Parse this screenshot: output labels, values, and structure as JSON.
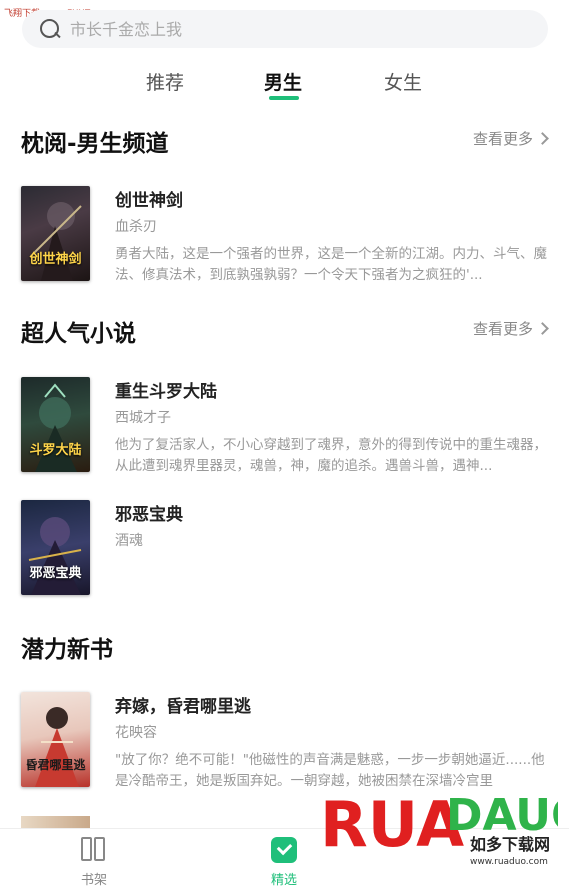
{
  "watermark": "飞翔下载 www.FXXZ.com",
  "search": {
    "placeholder": "市长千金恋上我"
  },
  "tabs": [
    {
      "label": "推荐"
    },
    {
      "label": "男生"
    },
    {
      "label": "女生"
    }
  ],
  "sections": [
    {
      "title": "枕阅-男生频道",
      "more": "查看更多",
      "books": [
        {
          "title": "创世神剑",
          "author": "血杀刃",
          "desc": "勇者大陆，这是一个强者的世界，这是一个全新的江湖。内力、斗气、魔法、修真法术，到底孰强孰弱？一个令天下强者为之疯狂的'...",
          "cover_text": "创世神剑"
        }
      ]
    },
    {
      "title": "超人气小说",
      "more": "查看更多",
      "books": [
        {
          "title": "重生斗罗大陆",
          "author": "西城才子",
          "desc": "他为了复活家人，不小心穿越到了魂界，意外的得到传说中的重生魂器，从此遭到魂界里器灵，魂兽，神，魔的追杀。遇兽斗兽，遇神...",
          "cover_text": "斗罗大陆"
        },
        {
          "title": "邪恶宝典",
          "author": "酒魂",
          "desc": "",
          "cover_text": "邪恶宝典"
        }
      ]
    },
    {
      "title": "潜力新书",
      "more": "",
      "books": [
        {
          "title": "弃嫁，昏君哪里逃",
          "author": "花映容",
          "desc": "\"放了你？绝不可能！\"他磁性的声音满是魅惑，一步一步朝她逼近......他是冷酷帝王，她是叛国弃妃。一朝穿越，她被困禁在深墙冷宫里",
          "cover_text": "昏君哪里逃"
        }
      ]
    }
  ],
  "bottom_nav": [
    {
      "label": "书架",
      "icon": "bookshelf-icon"
    },
    {
      "label": "精选",
      "icon": "featured-icon"
    }
  ],
  "logo": {
    "text": "RUADADUO",
    "sub": "如多下载网",
    "url": "www.ruaduo.com"
  },
  "colors": {
    "accent": "#1fbf7a",
    "logo_red": "#e02020",
    "logo_green": "#2fb34a"
  }
}
